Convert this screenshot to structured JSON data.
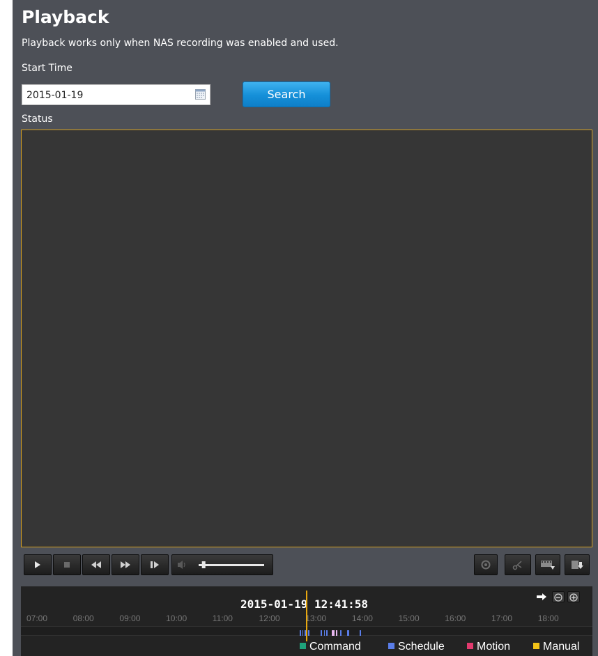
{
  "page": {
    "title": "Playback",
    "description": "Playback works only when NAS recording was enabled and used.",
    "start_time_label": "Start Time",
    "status_label": "Status"
  },
  "search": {
    "date_value": "2015-01-19",
    "button_label": "Search",
    "button_color": "#148fd8"
  },
  "player": {
    "border_color": "#d8a21f",
    "volume_level_percent": 5
  },
  "timeline": {
    "timestamp": "2015-01-19 12:41:58",
    "hours": [
      "07:00",
      "08:00",
      "09:00",
      "10:00",
      "11:00",
      "12:00",
      "13:00",
      "14:00",
      "15:00",
      "16:00",
      "17:00",
      "18:00"
    ],
    "legend": [
      {
        "label": "Command",
        "color": "#1fa27a"
      },
      {
        "label": "Schedule",
        "color": "#5a7de8"
      },
      {
        "label": "Motion",
        "color": "#e23a6e"
      },
      {
        "label": "Manual",
        "color": "#f2c318"
      }
    ]
  }
}
